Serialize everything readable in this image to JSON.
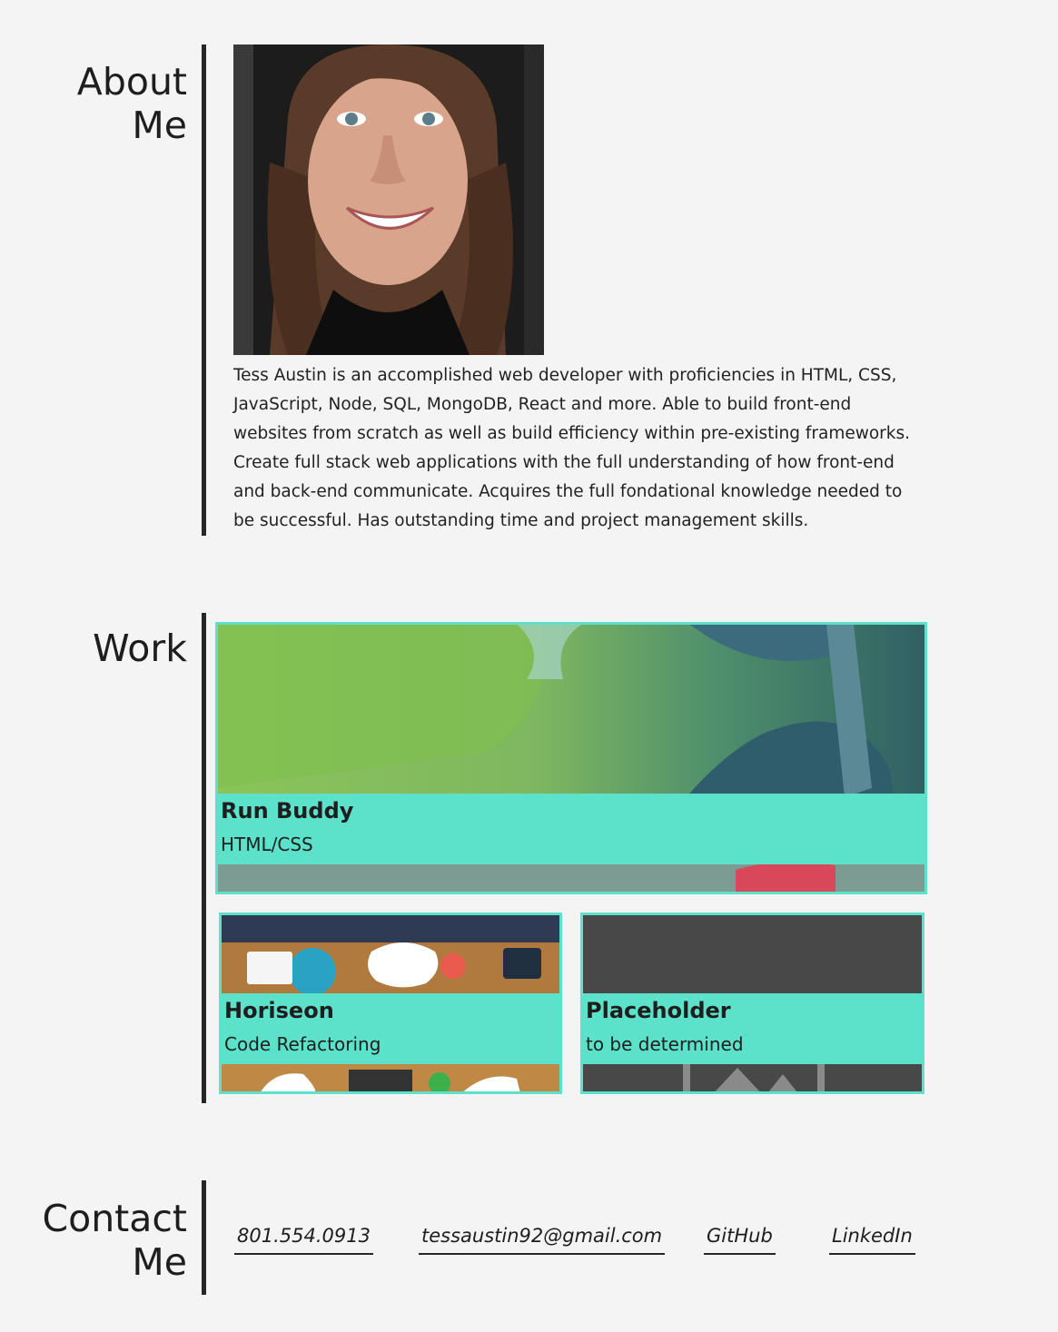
{
  "about": {
    "title": "About Me",
    "bio": "Tess Austin is an accomplished web developer with proficiencies in HTML, CSS, JavaScript, Node, SQL, MongoDB, React and more. Able to build front-end websites from scratch as well as build efficiency within pre-existing frameworks. Create full stack web applications with the full understanding of how front-end and back-end communicate. Acquires the full fondational knowledge needed to be successful. Has outstanding time and project management skills."
  },
  "work": {
    "title": "Work",
    "projects": [
      {
        "title": "Run Buddy",
        "subtitle": "HTML/CSS"
      },
      {
        "title": "Horiseon",
        "subtitle": "Code Refactoring"
      },
      {
        "title": "Placeholder",
        "subtitle": "to be determined"
      }
    ]
  },
  "contact": {
    "title": "Contact Me",
    "phone": "801.554.0913",
    "email": "tessaustin92@gmail.com",
    "github": "GitHub",
    "linkedin": "LinkedIn"
  },
  "colors": {
    "background": "#f4f4f4",
    "accent": "#5ce1cb",
    "text": "#1e1e1e",
    "divider": "#262626"
  }
}
